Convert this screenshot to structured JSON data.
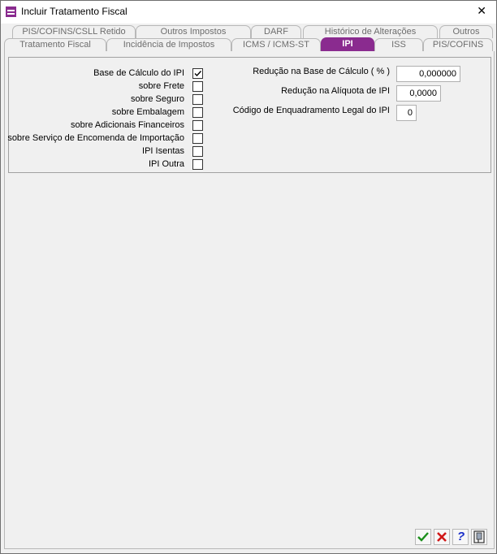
{
  "window": {
    "title": "Incluir Tratamento Fiscal",
    "close_glyph": "✕",
    "accent": "#8a2b8f"
  },
  "tabs_back": [
    "PIS/COFINS/CSLL Retido",
    "Outros Impostos",
    "DARF",
    "Histórico de Alterações",
    "Outros"
  ],
  "tabs_front": [
    "Tratamento Fiscal",
    "Incidência de Impostos",
    "ICMS / ICMS-ST",
    "IPI",
    "ISS",
    "PIS/COFINS"
  ],
  "active_tab": "IPI",
  "checkboxes": [
    {
      "label": "Base de Cálculo do IPI",
      "checked": true
    },
    {
      "label": "sobre Frete",
      "checked": false
    },
    {
      "label": "sobre Seguro",
      "checked": false
    },
    {
      "label": "sobre Embalagem",
      "checked": false
    },
    {
      "label": "sobre Adicionais Financeiros",
      "checked": false
    },
    {
      "label": "sobre Serviço de Encomenda de Importação",
      "checked": false
    },
    {
      "label": "IPI Isentas",
      "checked": false
    },
    {
      "label": "IPI Outra",
      "checked": false
    }
  ],
  "fields": [
    {
      "label": "Redução na Base de Cálculo ( % )",
      "value": "0,000000"
    },
    {
      "label": "Redução na Alíquota de IPI",
      "value": "0,0000"
    },
    {
      "label": "Código de Enquadramento Legal do IPI",
      "value": "0"
    }
  ],
  "buttons": [
    {
      "name": "confirm",
      "icon": "check-icon",
      "glyph": "✔",
      "color": "#1a8f1a"
    },
    {
      "name": "cancel",
      "icon": "x-icon",
      "glyph": "✖",
      "color": "#d01818"
    },
    {
      "name": "help",
      "icon": "question-icon",
      "glyph": "?",
      "color": "#1b2fc9"
    },
    {
      "name": "exit",
      "icon": "door-exit-icon",
      "glyph": "",
      "color": "#333333"
    }
  ]
}
